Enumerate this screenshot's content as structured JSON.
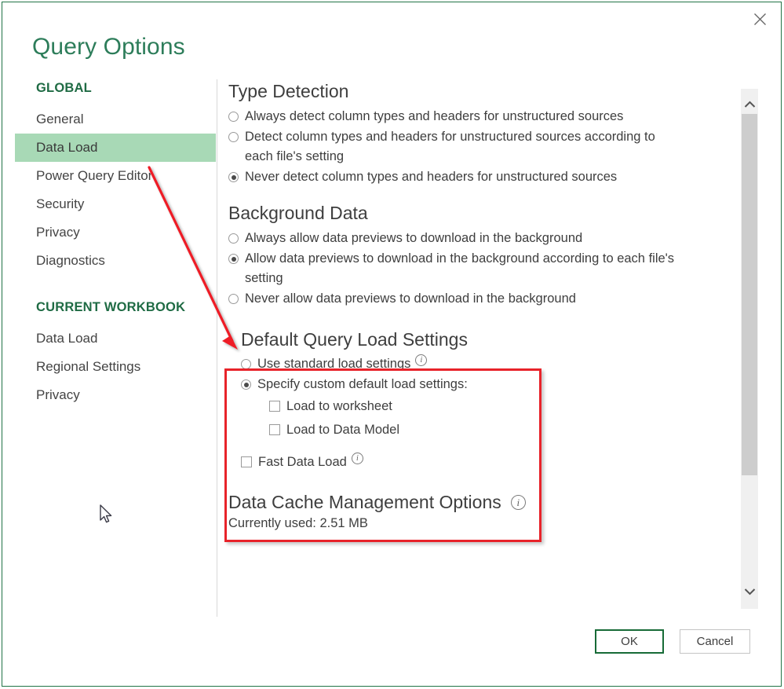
{
  "window": {
    "title": "Query Options",
    "close_icon": "close-icon",
    "accent_color": "#217346",
    "title_color": "#2d7d5a"
  },
  "sidebar": {
    "groups": [
      {
        "title": "GLOBAL",
        "items": [
          {
            "label": "General",
            "active": false
          },
          {
            "label": "Data Load",
            "active": true
          },
          {
            "label": "Power Query Editor",
            "active": false
          },
          {
            "label": "Security",
            "active": false
          },
          {
            "label": "Privacy",
            "active": false
          },
          {
            "label": "Diagnostics",
            "active": false
          }
        ]
      },
      {
        "title": "CURRENT WORKBOOK",
        "items": [
          {
            "label": "Data Load",
            "active": false
          },
          {
            "label": "Regional Settings",
            "active": false
          },
          {
            "label": "Privacy",
            "active": false
          }
        ]
      }
    ],
    "highlight_color": "#a8d9b6"
  },
  "content": {
    "type_detection": {
      "heading": "Type Detection",
      "options": [
        {
          "label": "Always detect column types and headers for unstructured sources",
          "selected": false
        },
        {
          "label": "Detect column types and headers for unstructured sources according to each file's setting",
          "selected": false
        },
        {
          "label": "Never detect column types and headers for unstructured sources",
          "selected": true
        }
      ]
    },
    "background_data": {
      "heading": "Background Data",
      "options": [
        {
          "label": "Always allow data previews to download in the background",
          "selected": false
        },
        {
          "label": "Allow data previews to download in the background according to each file's setting",
          "selected": true
        },
        {
          "label": "Never allow data previews to download in the background",
          "selected": false
        }
      ]
    },
    "default_query_load": {
      "heading": "Default Query Load Settings",
      "highlighted": true,
      "highlight_border_color": "#e8232a",
      "options": [
        {
          "label": "Use standard load settings",
          "selected": false,
          "info": true
        },
        {
          "label": "Specify custom default load settings:",
          "selected": true,
          "info": false
        }
      ],
      "checkboxes": [
        {
          "label": "Load to worksheet",
          "checked": false
        },
        {
          "label": "Load to Data Model",
          "checked": false
        }
      ],
      "fast_data_load": {
        "label": "Fast Data Load",
        "checked": false,
        "info": true
      }
    },
    "data_cache": {
      "heading": "Data Cache Management Options",
      "info": true,
      "currently_used": "Currently used: 2.51 MB"
    }
  },
  "scrollbar": {
    "up_icon": "chevron-up-icon",
    "down_icon": "chevron-down-icon"
  },
  "footer": {
    "ok_label": "OK",
    "cancel_label": "Cancel"
  },
  "annotation": {
    "arrow_color": "#ee1c25",
    "arrow_from": "Data Load (Global)",
    "arrow_to": "Never allow data previews to download in the background"
  }
}
